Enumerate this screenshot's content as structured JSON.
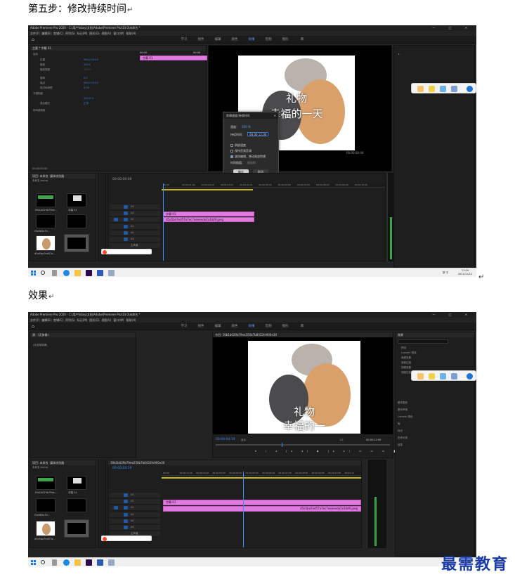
{
  "doc": {
    "step5_heading": "第五步：修改持续时间",
    "effect_heading": "效果",
    "watermark": "最需教育"
  },
  "app": {
    "title": "Adobe Premiere Pro 2020 - C:\\用户\\hbxy\\文档\\Adobe\\Premiere Pro\\14.0\\未命名 *",
    "window_controls": "— □ ✕",
    "menu": [
      "文件(F)",
      "编辑(E)",
      "剪辑(C)",
      "序列(S)",
      "标记(M)",
      "图形(G)",
      "视图(V)",
      "窗口(W)",
      "帮助(H)"
    ],
    "workspaces": [
      "学习",
      "组件",
      "编辑",
      "颜色",
      "效果",
      "音频",
      "图形",
      "库"
    ],
    "active_workspace": "效果"
  },
  "shot1": {
    "effect_controls_header": "主要 * 字幕 01",
    "effect_panel_items": [
      "运动",
      "位置",
      "缩放",
      "缩放宽度",
      "旋转",
      "锚点",
      "防闪烁滤镜",
      "不透明度",
      "混合模式",
      "时间重映射"
    ],
    "effect_values": [
      "960.0  540.0",
      "100.0",
      "100.0",
      "0.0",
      "960.0  540.0",
      "0.00",
      "100.0 %",
      "正常"
    ],
    "effect_timeline_tc": "00:00",
    "effect_timeline_tc2": "00:00",
    "effect_clip_label": "字幕 01",
    "bottom_left_tc": "00:00:00:00",
    "program_tc": "00:00:00:00",
    "subtitle_line1": "礼物",
    "subtitle_line2": "幸福的一天",
    "dialog": {
      "title": "剪辑速度/持续时间",
      "speed_label": "速度：",
      "speed_value": "100 %",
      "duration_label": "持续时间：",
      "duration_value": "00:00:12;00",
      "options": [
        "倒放速度",
        "保持音频音调",
        "波纹编辑，移动尾部剪辑"
      ],
      "interp_label": "时间插值：",
      "interp_value": "帧采样",
      "ok": "确定",
      "cancel": "取消"
    },
    "project_tabs": [
      "项目: 未命名",
      "媒体浏览器"
    ],
    "project_file": "未命名.prproj",
    "media_labels": [
      "19b1b029b79ee...",
      "字幕 01",
      "f2a9b5a7e...",
      "d5e5ba7ed57a..."
    ],
    "timeline_tc": "00:00:00:00",
    "timeline_ticks": [
      "00:00",
      "00:00:01:00",
      "00:00:02:00",
      "00:00:03:00",
      "00:00:04:00",
      "00:00:05:00",
      "00:00:06:00",
      "00:00:07:00",
      "00:00:08:00",
      "00:00:09:00",
      "00:00:10:00"
    ],
    "track_labels": [
      "V3",
      "V2",
      "V1",
      "A1",
      "A2",
      "A3",
      "主声道"
    ],
    "clip_v2": "字幕 01",
    "clip_v1": "d5e5ba7ed57a7ec7eeeeede2c4dd9.jpeg",
    "clock_time": "11:09",
    "clock_date": "2021/11/12",
    "tray": "拼 中"
  },
  "shot2": {
    "source_header": "源：(无剪辑)",
    "source_empty": "(未选择剪辑)",
    "program_header": "节目: 19b1b029b79ee250b7b8432fe900e30",
    "program_tc": "00:00:04:19",
    "fit_label": "适合",
    "fraction": "1/2",
    "program_end_tc": "00:00:12:00",
    "subtitle_line1": "礼物",
    "subtitle_line2": "幸福的一",
    "effects_header": "效果",
    "effects_tree": [
      "预设",
      "Lumetri 预设",
      "音频效果",
      "音频过渡",
      "视频效果",
      "视频过渡"
    ],
    "side_panels": [
      "基本图形",
      "基本声音",
      "Lumetri 颜色",
      "库",
      "标记",
      "历史记录",
      "信息"
    ],
    "project_tabs": [
      "项目: 未命名",
      "媒体浏览器"
    ],
    "media_labels": [
      "19b1b029b79ee...",
      "字幕 01",
      "f2a9b5a7e...",
      "d5e5ba7ed57a..."
    ],
    "timeline_header": "19b1b029b79ee250b7b8432fe900e30",
    "timeline_tc": "00:00:04:19",
    "timeline_ticks": [
      "00:00",
      "00:00:01:00",
      "00:00:02:00",
      "00:00:03:00",
      "00:00:04:00",
      "00:00:05:00",
      "00:00:06:00",
      "00:00:07:00",
      "00:00:08:00",
      "00:00:09:00",
      "00:00:10:00",
      "00:00:11"
    ],
    "track_labels": [
      "V3",
      "V2",
      "V1",
      "A1",
      "A2",
      "A3",
      "主声道"
    ],
    "clip_v2": "字幕 01",
    "clip_v1": "d5e5ba7ed57a7ec7eeeeede2c4dd9.jpeg"
  },
  "colors": {
    "clip_pink": "#e07be0",
    "accent_blue": "#3b8cff",
    "watermark_blue": "#1a3aa8"
  }
}
